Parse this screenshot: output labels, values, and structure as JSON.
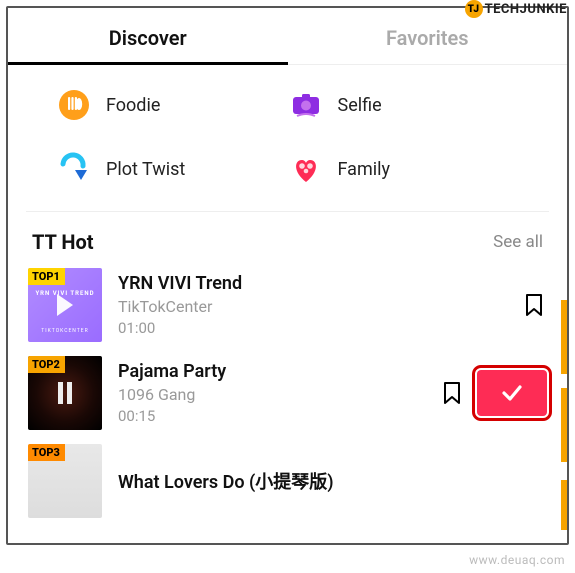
{
  "watermark": {
    "top": "TECHJUNKIE",
    "bottom": "www.deuaq.com"
  },
  "tabs": {
    "discover": "Discover",
    "favorites": "Favorites"
  },
  "categories": {
    "foodie": "Foodie",
    "selfie": "Selfie",
    "plottwist": "Plot Twist",
    "family": "Family"
  },
  "section": {
    "title": "TT Hot",
    "see_all": "See all"
  },
  "badges": {
    "top1": "TOP1",
    "top2": "TOP2",
    "top3": "TOP3"
  },
  "tracks": [
    {
      "title": "YRN VIVI Trend",
      "artist": "TikTokCenter",
      "duration": "01:00",
      "cover_text": "YRN VIVI TREND",
      "cover_sub": "TIKTOKCENTER"
    },
    {
      "title": "Pajama Party",
      "artist": "1096 Gang",
      "duration": "00:15"
    },
    {
      "title": "What Lovers Do (小提琴版)"
    }
  ]
}
